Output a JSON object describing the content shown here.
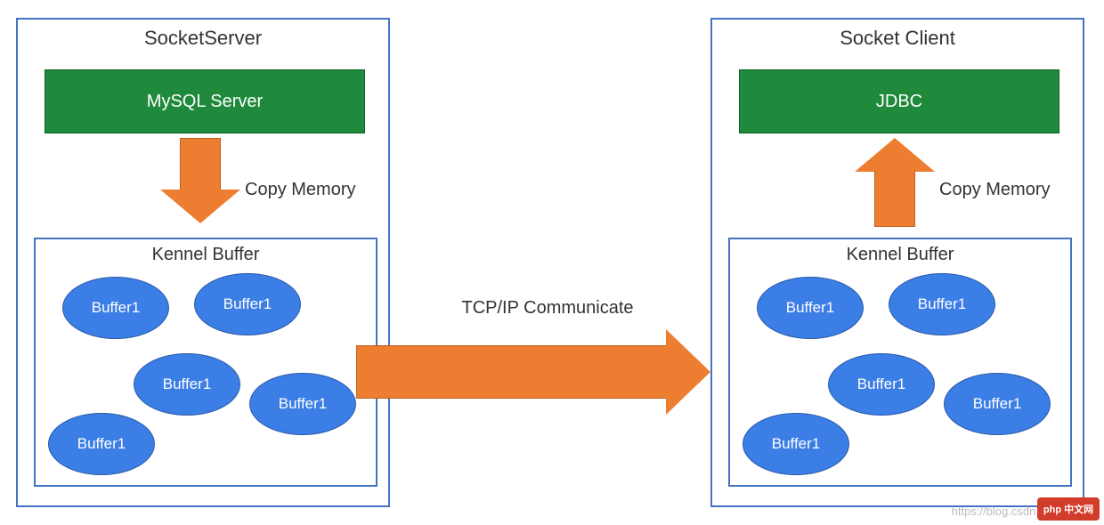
{
  "left_panel": {
    "title": "SocketServer",
    "green_box": "MySQL Server",
    "copy_memory": "Copy Memory",
    "kernel_buffer": {
      "title": "Kennel Buffer",
      "buffers": [
        "Buffer1",
        "Buffer1",
        "Buffer1",
        "Buffer1",
        "Buffer1"
      ]
    }
  },
  "right_panel": {
    "title": "Socket Client",
    "green_box": "JDBC",
    "copy_memory": "Copy Memory",
    "kernel_buffer": {
      "title": "Kennel Buffer",
      "buffers": [
        "Buffer1",
        "Buffer1",
        "Buffer1",
        "Buffer1",
        "Buffer1"
      ]
    }
  },
  "tcp_label": "TCP/IP Communicate",
  "watermark": "https://blog.csdn.net",
  "logo": "php 中文网"
}
